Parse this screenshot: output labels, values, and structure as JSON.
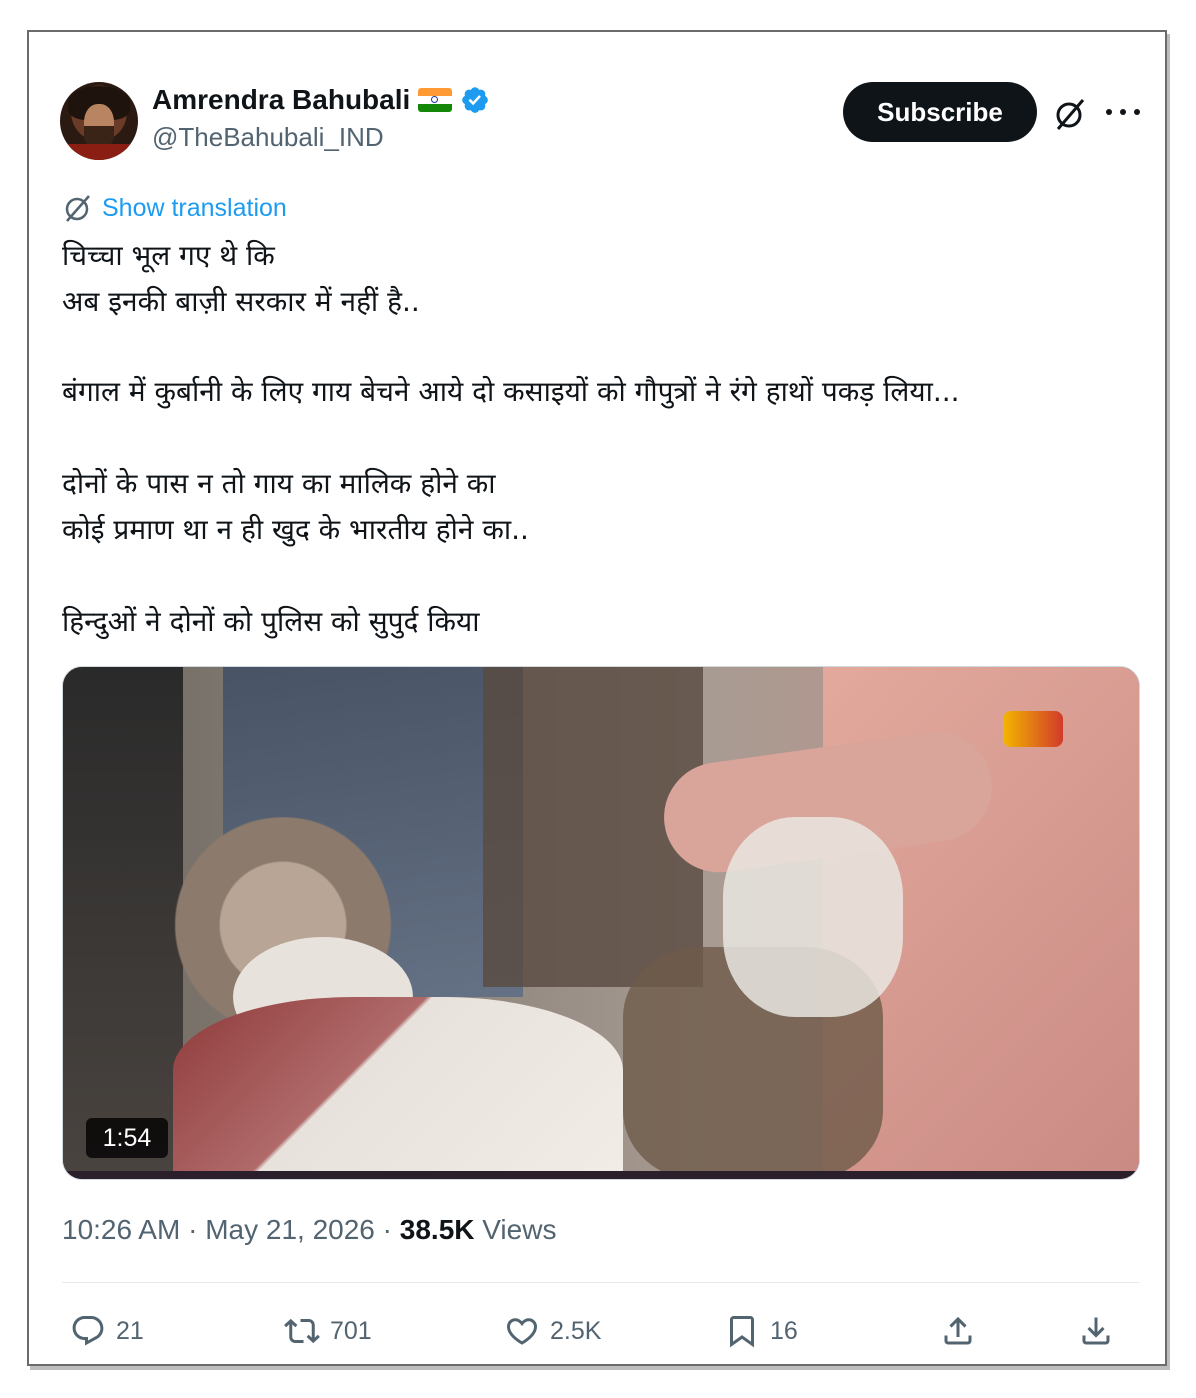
{
  "author": {
    "name": "Amrendra Bahubali",
    "handle": "@TheBahubali_IND",
    "flag": "india-flag",
    "verified_color": "#1d9bf0"
  },
  "header": {
    "subscribe_label": "Subscribe",
    "grok_icon": "grok-icon",
    "more_icon": "more-icon"
  },
  "translate_label": "Show translation",
  "tweet_lines": [
    "चिच्चा भूल गए थे कि",
    "अब इनकी बाज़ी सरकार में नहीं है..",
    "बंगाल में कुर्बानी के लिए गाय बेचने आये दो कसाइयों को गौपुत्रों ने रंगे हाथों पकड़ लिया...",
    "दोनों के पास न तो गाय का मालिक होने का",
    "कोई प्रमाण था न ही खुद के भारतीय होने का..",
    "हिन्दुओं ने दोनों को पुलिस को सुपुर्द किया"
  ],
  "media": {
    "duration": "1:54"
  },
  "meta": {
    "time": "10:26 AM",
    "sep": " · ",
    "date": "May 21, 2026",
    "views_count": "38.5K",
    "views_label": "Views"
  },
  "actions": {
    "replies": "21",
    "reposts": "701",
    "likes": "2.5K",
    "bookmarks": "16"
  },
  "colors": {
    "accent": "#1d9bf0",
    "text": "#0f1419",
    "secondary": "#536471"
  }
}
